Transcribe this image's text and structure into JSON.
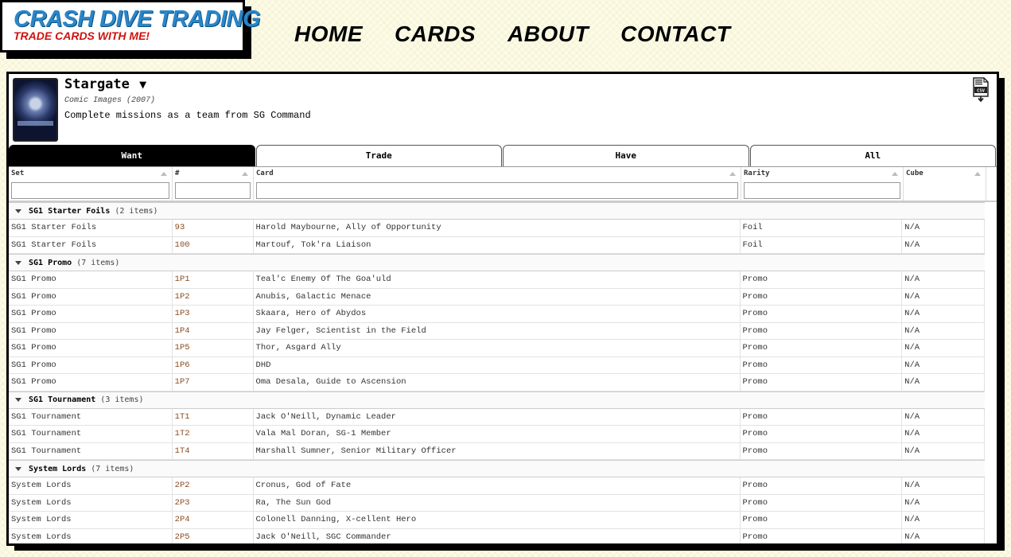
{
  "header": {
    "logo_title": "Crash Dive Trading",
    "logo_subtitle": "Trade cards with me!",
    "nav": [
      "HOME",
      "CARDS",
      "ABOUT",
      "CONTACT"
    ]
  },
  "set": {
    "title": "Stargate",
    "caret": "▼",
    "meta": "Comic Images (2007)",
    "description": "Complete missions as a team from SG Command",
    "csv_icon": "csv-download-icon",
    "csv_label": "CSV"
  },
  "tabs": [
    {
      "label": "Want",
      "active": true
    },
    {
      "label": "Trade",
      "active": false
    },
    {
      "label": "Have",
      "active": false
    },
    {
      "label": "All",
      "active": false
    }
  ],
  "columns": [
    "Set",
    "#",
    "Card",
    "Rarity",
    "Cube"
  ],
  "groups": [
    {
      "name": "SG1 Starter Foils",
      "count": "(2 items)",
      "rows": [
        [
          "SG1 Starter Foils",
          "93",
          "Harold Maybourne, Ally of Opportunity",
          "Foil",
          "N/A"
        ],
        [
          "SG1 Starter Foils",
          "100",
          "Martouf, Tok'ra Liaison",
          "Foil",
          "N/A"
        ]
      ]
    },
    {
      "name": "SG1 Promo",
      "count": "(7 items)",
      "rows": [
        [
          "SG1 Promo",
          "1P1",
          "Teal'c Enemy Of The Goa'uld",
          "Promo",
          "N/A"
        ],
        [
          "SG1 Promo",
          "1P2",
          "Anubis, Galactic Menace",
          "Promo",
          "N/A"
        ],
        [
          "SG1 Promo",
          "1P3",
          "Skaara, Hero of Abydos",
          "Promo",
          "N/A"
        ],
        [
          "SG1 Promo",
          "1P4",
          "Jay Felger, Scientist in the Field",
          "Promo",
          "N/A"
        ],
        [
          "SG1 Promo",
          "1P5",
          "Thor, Asgard Ally",
          "Promo",
          "N/A"
        ],
        [
          "SG1 Promo",
          "1P6",
          "DHD",
          "Promo",
          "N/A"
        ],
        [
          "SG1 Promo",
          "1P7",
          "Oma Desala, Guide to Ascension",
          "Promo",
          "N/A"
        ]
      ]
    },
    {
      "name": "SG1 Tournament",
      "count": "(3 items)",
      "rows": [
        [
          "SG1 Tournament",
          "1T1",
          "Jack O'Neill, Dynamic Leader",
          "Promo",
          "N/A"
        ],
        [
          "SG1 Tournament",
          "1T2",
          "Vala Mal Doran, SG-1 Member",
          "Promo",
          "N/A"
        ],
        [
          "SG1 Tournament",
          "1T4",
          "Marshall Sumner, Senior Military Officer",
          "Promo",
          "N/A"
        ]
      ]
    },
    {
      "name": "System Lords",
      "count": "(7 items)",
      "rows": [
        [
          "System Lords",
          "2P2",
          "Cronus, God of Fate",
          "Promo",
          "N/A"
        ],
        [
          "System Lords",
          "2P3",
          "Ra, The Sun God",
          "Promo",
          "N/A"
        ],
        [
          "System Lords",
          "2P4",
          "Colonell Danning, X-cellent Hero",
          "Promo",
          "N/A"
        ],
        [
          "System Lords",
          "2P5",
          "Jack O'Neill, SGC Commander",
          "Promo",
          "N/A"
        ]
      ]
    }
  ]
}
